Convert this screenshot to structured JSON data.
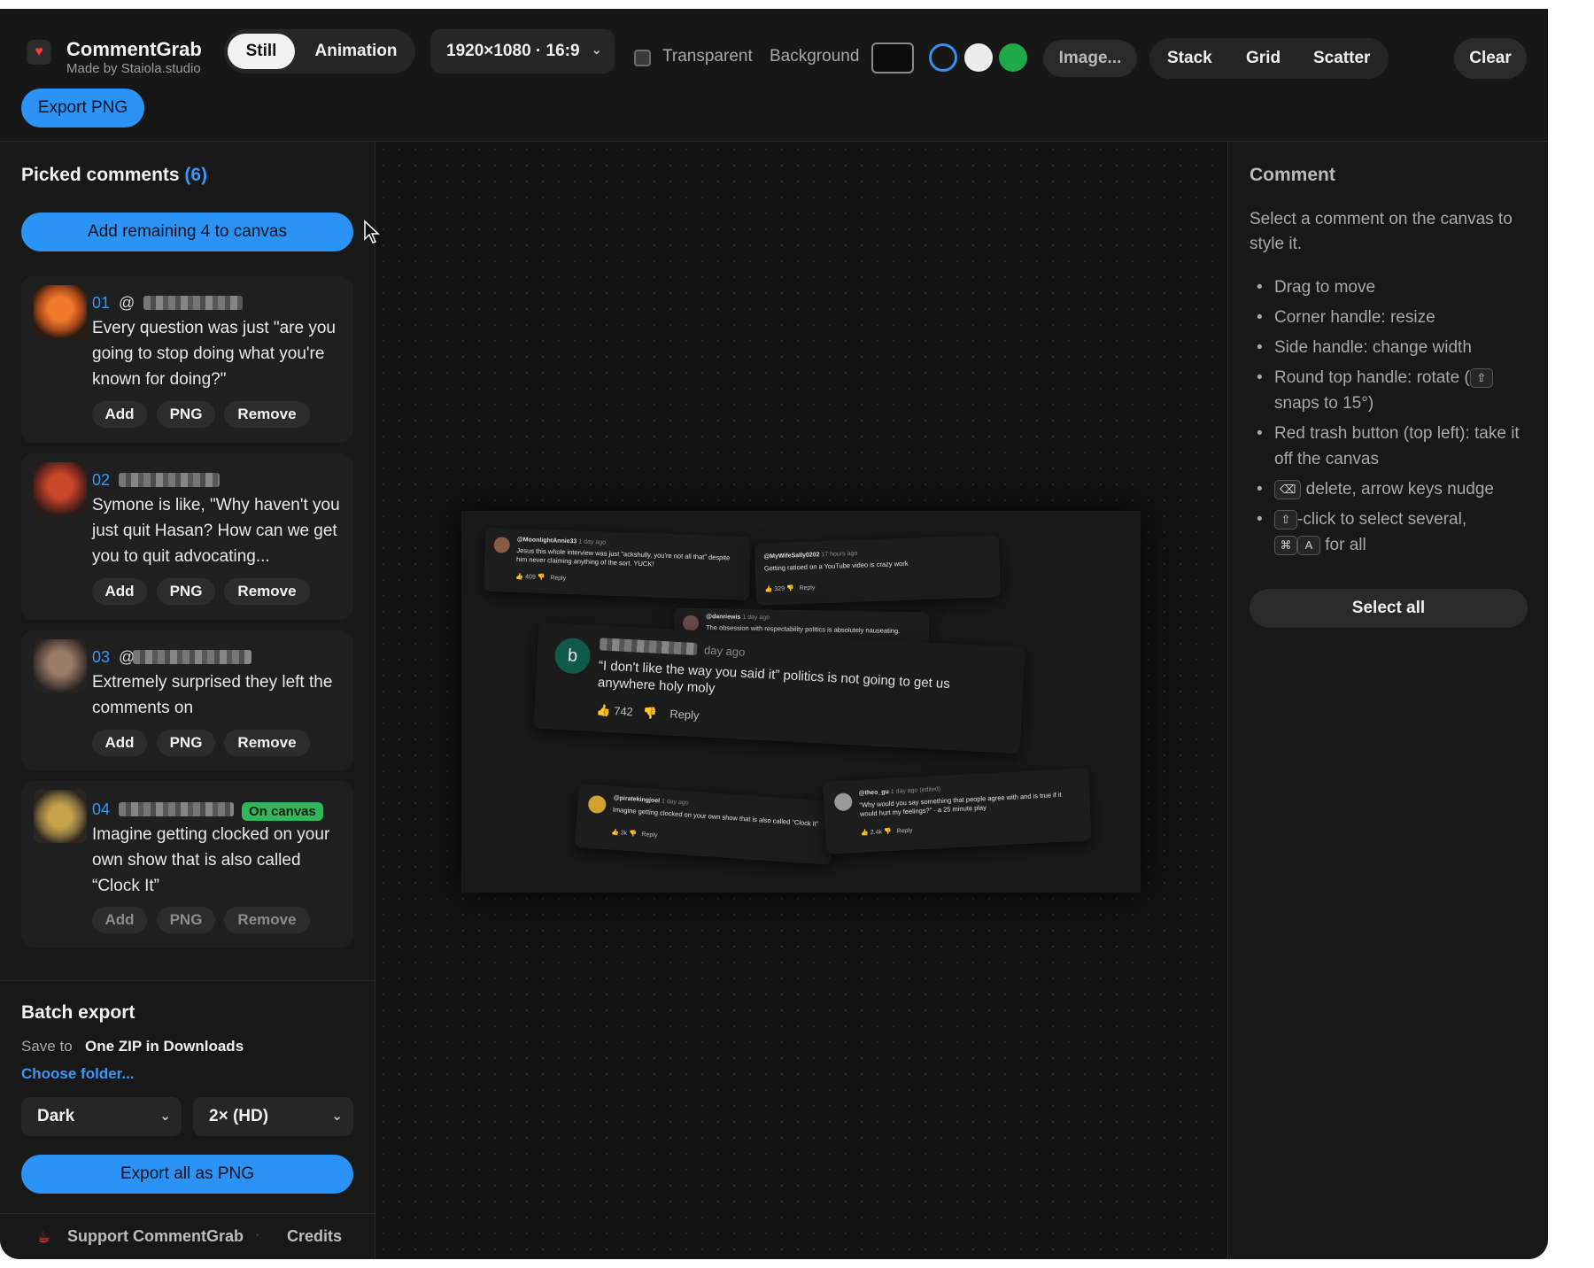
{
  "brand": {
    "name": "CommentGrab",
    "sub": "Made by Staiola.studio",
    "icon": "heart-icon"
  },
  "toolbar": {
    "mode_still": "Still",
    "mode_animation": "Animation",
    "resolution": "1920×1080 · 16:9",
    "transparent_label": "Transparent",
    "background_label": "Background",
    "image_button": "Image...",
    "stack": "Stack",
    "grid": "Grid",
    "scatter": "Scatter",
    "clear": "Clear",
    "export_png": "Export PNG",
    "swatch_colors": [
      "#0d0d0d",
      "#3b8df2",
      "#ececec",
      "#1ea84a"
    ]
  },
  "left": {
    "picked_title": "Picked comments",
    "picked_count": "(6)",
    "add_remaining": "Add remaining 4 to canvas",
    "cards": [
      {
        "num": "01",
        "at": "@",
        "text": "Every question was just \"are you going to stop doing what you're known for doing?\"",
        "add": "Add",
        "png": "PNG",
        "remove": "Remove"
      },
      {
        "num": "02",
        "text": "Symone is like, \"Why haven't you just quit Hasan? How can we get you to quit advocating...",
        "add": "Add",
        "png": "PNG",
        "remove": "Remove"
      },
      {
        "num": "03",
        "at": "@",
        "text": "Extremely surprised they left the comments on",
        "add": "Add",
        "png": "PNG",
        "remove": "Remove"
      },
      {
        "num": "04",
        "badge": "On canvas",
        "text": "Imagine getting clocked on your own show that is also called “Clock It”",
        "add": "Add",
        "png": "PNG",
        "remove": "Remove"
      }
    ],
    "batch": {
      "title": "Batch export",
      "save_to": "Save to",
      "save_value": "One ZIP in Downloads",
      "choose_folder": "Choose folder...",
      "theme": "Dark",
      "scale": "2× (HD)",
      "export_all": "Export all as PNG"
    },
    "footer": {
      "support": "Support CommentGrab",
      "sep": "·",
      "credits": "Credits"
    }
  },
  "canvas": {
    "comments": [
      {
        "user": "@MoonlightAnnie33",
        "time": "1 day ago",
        "text": "Jesus this whole interview was just \"ackshully, you're not all that\" despite him never claiming anything of the sort. YUCK!",
        "likes": "409",
        "reply": "Reply"
      },
      {
        "user": "@MyWifeSally0202",
        "time": "17 hours ago",
        "text": "Getting ratioed on a YouTube video is crazy work",
        "likes": "329",
        "reply": "Reply"
      },
      {
        "user": "@danriewis",
        "time": "1 day ago",
        "text": "The obsession with respectability politics is absolutely nauseating.",
        "likes": "",
        "reply": ""
      },
      {
        "avatar_letter": "b",
        "time": "day ago",
        "text": "“I don't like the way you said it” politics is not going to get us anywhere holy moly",
        "likes": "742",
        "reply": "Reply"
      },
      {
        "user": "@piratekingjoel",
        "time": "1 day ago",
        "text": "Imagine getting clocked on your own show that is also called “Clock It”",
        "likes": "3k",
        "reply": "Reply"
      },
      {
        "user": "@theo_gu",
        "time": "1 day ago (edited)",
        "text": "“Why would you say something that people agree with and is true if it would hurt my feelings?” - a 25 minute play",
        "likes": "2.4k",
        "reply": "Reply"
      }
    ]
  },
  "right": {
    "title": "Comment",
    "hint": "Select a comment on the canvas to style it.",
    "tips": {
      "drag": "Drag to move",
      "corner": "Corner handle: resize",
      "side": "Side handle: change width",
      "rotate_a": "Round top handle: rotate (",
      "rotate_b": "snaps to 15°)",
      "trash": "Red trash button (top left): take it off the canvas",
      "delete": "delete, arrow keys nudge",
      "shift_click": "-click to select several,",
      "for_all": "for all"
    },
    "keys": {
      "shift": "⇧",
      "backspace": "⌫",
      "cmd": "⌘",
      "a": "A"
    },
    "select_all": "Select all"
  }
}
